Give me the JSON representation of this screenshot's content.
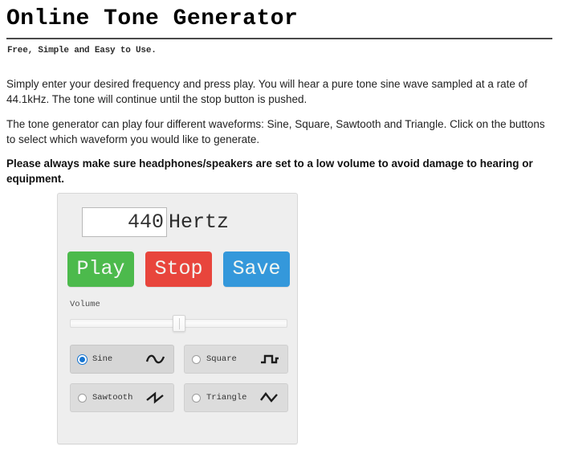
{
  "header": {
    "title": "Online Tone Generator",
    "tagline": "Free, Simple and Easy to Use."
  },
  "intro": {
    "paragraph1": "Simply enter your desired frequency and press play. You will hear a pure tone sine wave sampled at a rate of 44.1kHz. The tone will continue until the stop button is pushed.",
    "paragraph2": "The tone generator can play four different waveforms: Sine, Square, Sawtooth and Triangle. Click on the buttons to select which waveform you would like to generate.",
    "warning": "Please always make sure headphones/speakers are set to a low volume to avoid damage to hearing or equipment."
  },
  "generator": {
    "frequency": {
      "value": "440",
      "placeholder": "440",
      "unit_label": "Hertz"
    },
    "buttons": [
      {
        "label": "Play",
        "name": "play-button",
        "color": "#4cba4c"
      },
      {
        "label": "Stop",
        "name": "stop-button",
        "color": "#e8453c"
      },
      {
        "label": "Save",
        "name": "save-button",
        "color": "#3498db"
      }
    ],
    "volume": {
      "label": "Volume",
      "value": 50
    },
    "waveforms": [
      {
        "label": "Sine",
        "icon": "sine-wave-icon",
        "selected": true
      },
      {
        "label": "Square",
        "icon": "square-wave-icon",
        "selected": false
      },
      {
        "label": "Sawtooth",
        "icon": "sawtooth-wave-icon",
        "selected": false
      },
      {
        "label": "Triangle",
        "icon": "triangle-wave-icon",
        "selected": false
      }
    ]
  },
  "colors": {
    "panel_background": "#eeeeee",
    "option_background": "#dcdcdc",
    "radio_selected": "#1675d1"
  }
}
